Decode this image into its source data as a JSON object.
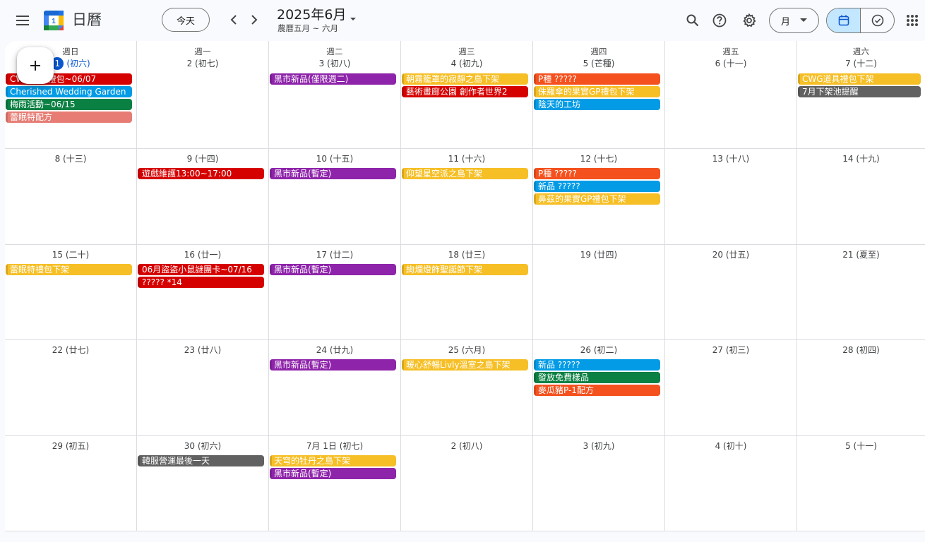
{
  "header": {
    "app_title": "日曆",
    "today_label": "今天",
    "date_title": "2025年6月",
    "date_subtitle": "農曆五月 ~ 六月",
    "view_label": "月",
    "logo_day": "1"
  },
  "colors": {
    "red": "#d50000",
    "blue": "#039be5",
    "green": "#0b8043",
    "salmon": "#e67c73",
    "purple": "#8e24aa",
    "yellow": "#f6bf26",
    "orange": "#f4511e",
    "grey": "#616161",
    "today": "#0b57d0"
  },
  "icons": [
    "main-menu-icon",
    "chevron-left-icon",
    "chevron-right-icon",
    "dropdown-arrow-icon",
    "search-icon",
    "help-icon",
    "settings-icon",
    "calendar-view-icon",
    "tasks-check-icon",
    "apps-grid-icon",
    "plus-icon"
  ],
  "weekdays": [
    "週日",
    "週一",
    "週二",
    "週三",
    "週四",
    "週五",
    "週六"
  ],
  "weeks": [
    [
      {
        "day": "1",
        "lunar": "(初六)",
        "today": true,
        "events": [
          {
            "title": "CWG道具禮包~06/07",
            "color": "red"
          },
          {
            "title": "Cherished Wedding Garden",
            "color": "blue"
          },
          {
            "title": "梅雨活動~06/15",
            "color": "green"
          },
          {
            "title": "蕾眠特配方",
            "color": "salmon"
          }
        ]
      },
      {
        "day": "2",
        "lunar": "(初七)",
        "events": []
      },
      {
        "day": "3",
        "lunar": "(初八)",
        "events": [
          {
            "title": "黑市新品(僅限週二)",
            "color": "purple"
          }
        ]
      },
      {
        "day": "4",
        "lunar": "(初九)",
        "events": [
          {
            "title": "朝霧籠罩的寂靜之島下架",
            "color": "yellow"
          },
          {
            "title": "藝術畫廊公園 創作者世界2",
            "color": "red"
          }
        ]
      },
      {
        "day": "5",
        "lunar": "(芒種)",
        "events": [
          {
            "title": "P種 ?????",
            "color": "orange"
          },
          {
            "title": "侏羅傘的果實GP禮包下架",
            "color": "yellow"
          },
          {
            "title": "陰天的工坊",
            "color": "blue"
          }
        ]
      },
      {
        "day": "6",
        "lunar": "(十一)",
        "events": []
      },
      {
        "day": "7",
        "lunar": "(十二)",
        "events": [
          {
            "title": "CWG道具禮包下架",
            "color": "yellow"
          },
          {
            "title": "7月下架池提醒",
            "color": "grey"
          }
        ]
      }
    ],
    [
      {
        "day": "8",
        "lunar": "(十三)",
        "events": []
      },
      {
        "day": "9",
        "lunar": "(十四)",
        "events": [
          {
            "title": "遊戲維護13:00~17:00",
            "color": "red"
          }
        ]
      },
      {
        "day": "10",
        "lunar": "(十五)",
        "events": [
          {
            "title": "黑市新品(暫定)",
            "color": "purple"
          }
        ]
      },
      {
        "day": "11",
        "lunar": "(十六)",
        "events": [
          {
            "title": "仰望星空派之島下架",
            "color": "yellow"
          }
        ]
      },
      {
        "day": "12",
        "lunar": "(十七)",
        "events": [
          {
            "title": "P種 ?????",
            "color": "orange"
          },
          {
            "title": "新品 ?????",
            "color": "blue"
          },
          {
            "title": "鼻茲的果實GP禮包下架",
            "color": "yellow"
          }
        ]
      },
      {
        "day": "13",
        "lunar": "(十八)",
        "events": []
      },
      {
        "day": "14",
        "lunar": "(十九)",
        "events": []
      }
    ],
    [
      {
        "day": "15",
        "lunar": "(二十)",
        "events": [
          {
            "title": "蕾眠特禮包下架",
            "color": "yellow"
          }
        ]
      },
      {
        "day": "16",
        "lunar": "(廿一)",
        "events": [
          {
            "title": "06月盜盜小鼠謎團卡~07/16",
            "color": "red"
          },
          {
            "title": "????? *14",
            "color": "red"
          }
        ]
      },
      {
        "day": "17",
        "lunar": "(廿二)",
        "events": [
          {
            "title": "黑市新品(暫定)",
            "color": "purple"
          }
        ]
      },
      {
        "day": "18",
        "lunar": "(廿三)",
        "events": [
          {
            "title": "絢爛燈飾聖誕節下架",
            "color": "yellow"
          }
        ]
      },
      {
        "day": "19",
        "lunar": "(廿四)",
        "events": []
      },
      {
        "day": "20",
        "lunar": "(廿五)",
        "events": []
      },
      {
        "day": "21",
        "lunar": "(夏至)",
        "events": []
      }
    ],
    [
      {
        "day": "22",
        "lunar": "(廿七)",
        "events": []
      },
      {
        "day": "23",
        "lunar": "(廿八)",
        "events": []
      },
      {
        "day": "24",
        "lunar": "(廿九)",
        "events": [
          {
            "title": "黑市新品(暫定)",
            "color": "purple"
          }
        ]
      },
      {
        "day": "25",
        "lunar": "(六月)",
        "events": [
          {
            "title": "暖心舒暢Livly溫室之島下架",
            "color": "yellow"
          }
        ]
      },
      {
        "day": "26",
        "lunar": "(初二)",
        "events": [
          {
            "title": "新品 ?????",
            "color": "blue"
          },
          {
            "title": "發放免費樣品",
            "color": "green"
          },
          {
            "title": "麥瓜豬P-1配方",
            "color": "orange"
          }
        ]
      },
      {
        "day": "27",
        "lunar": "(初三)",
        "events": []
      },
      {
        "day": "28",
        "lunar": "(初四)",
        "events": []
      }
    ],
    [
      {
        "day": "29",
        "lunar": "(初五)",
        "events": []
      },
      {
        "day": "30",
        "lunar": "(初六)",
        "events": [
          {
            "title": "韓服營運最後一天",
            "color": "grey"
          }
        ]
      },
      {
        "day": "7月 1日",
        "lunar": "(初七)",
        "events": [
          {
            "title": "天穹的牡丹之島下架",
            "color": "yellow"
          },
          {
            "title": "黑市新品(暫定)",
            "color": "purple"
          }
        ]
      },
      {
        "day": "2",
        "lunar": "(初八)",
        "events": []
      },
      {
        "day": "3",
        "lunar": "(初九)",
        "events": []
      },
      {
        "day": "4",
        "lunar": "(初十)",
        "events": []
      },
      {
        "day": "5",
        "lunar": "(十一)",
        "events": []
      }
    ]
  ]
}
